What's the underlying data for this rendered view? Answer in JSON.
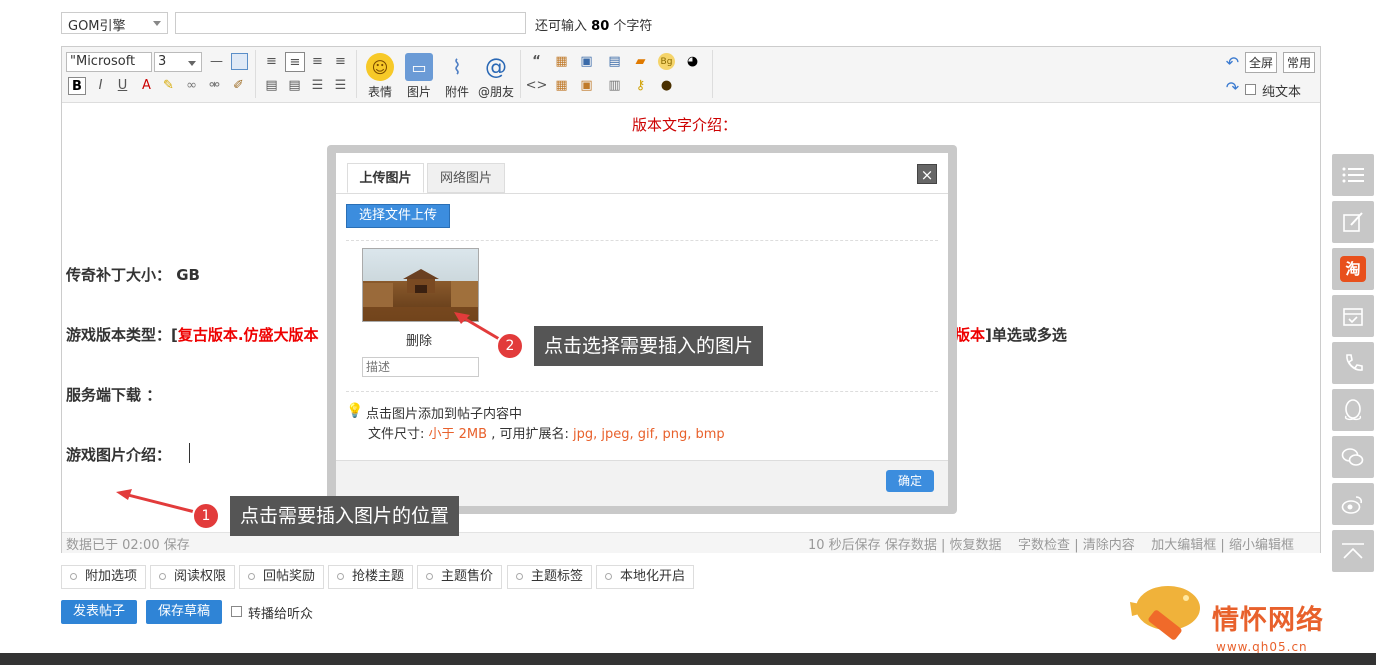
{
  "top": {
    "engine_select": "GOM引擎",
    "title_value": "",
    "char_note_prefix": "还可输入",
    "char_count": "80",
    "char_note_suffix": "个字符"
  },
  "toolbar": {
    "font_family": "\"Microsoft",
    "font_size": "3",
    "emoji_label": "表情",
    "image_label": "图片",
    "attach_label": "附件",
    "at_label": "@朋友",
    "fullscreen_label": "全屏",
    "common_label": "常用",
    "plaintext_label": "纯文本"
  },
  "content": {
    "intro_title": "版本文字介绍：",
    "patch_size_label": "传奇补丁大小：",
    "patch_size_unit": "GB",
    "version_type_label": "游戏版本类型：[",
    "version_type_red_left": "复古版本.仿盛大版本",
    "version_type_red_right": "版本",
    "version_type_suffix": "]单选或多选",
    "server_download_label": "服务端下载 ：",
    "game_images_label": "游戏图片介绍："
  },
  "status": {
    "saved_note": "数据已于 02:00 保存",
    "autosave": "10 秒后保存",
    "save_data": "保存数据",
    "restore_data": "恢复数据",
    "word_check": "字数检查",
    "clear_content": "清除内容",
    "enlarge": "加大编辑框",
    "shrink": "缩小编辑框"
  },
  "options": [
    "附加选项",
    "阅读权限",
    "回帖奖励",
    "抢楼主题",
    "主题售价",
    "主题标签",
    "本地化开启"
  ],
  "actions": {
    "publish": "发表帖子",
    "save_draft": "保存草稿",
    "forward_label": "转播给听众"
  },
  "modal": {
    "tab_upload": "上传图片",
    "tab_network": "网络图片",
    "close": "×",
    "upload_button": "选择文件上传",
    "delete_link": "删除",
    "desc_placeholder": "描述",
    "tip_line1": "点击图片添加到帖子内容中",
    "tip_size_prefix": "文件尺寸:",
    "tip_size_value": "小于 2MB",
    "tip_ext_prefix": ", 可用扩展名:",
    "tip_ext_value": "jpg, jpeg, gif, png, bmp",
    "ok_button": "确定"
  },
  "callouts": {
    "step1_num": "1",
    "step1_text": "点击需要插入图片的位置",
    "step2_num": "2",
    "step2_text": "点击选择需要插入的图片"
  },
  "sidebar_icons": [
    "list-icon",
    "edit-icon",
    "taobao-icon",
    "calendar-check-icon",
    "phone-icon",
    "qq-icon",
    "wechat-icon",
    "weibo-icon",
    "back-to-top-icon"
  ],
  "sidebar_taobao_char": "淘",
  "watermark": {
    "text": "情怀网络",
    "url": "www.qh05.cn"
  },
  "colors": {
    "primary_blue": "#2f84d6",
    "callout_bg": "#555555",
    "badge_red": "#e23b3b",
    "content_red": "#e00000",
    "orange_text": "#e8612c"
  }
}
